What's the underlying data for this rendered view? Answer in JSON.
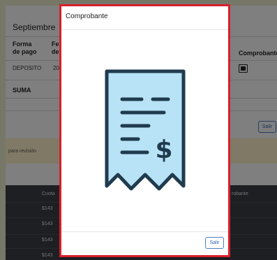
{
  "background": {
    "section_title": "Septiembre",
    "table_headers": [
      "Forma de pago",
      "Fe de",
      "Comprobante"
    ],
    "row": {
      "forma_pago": "DEPOSITO",
      "fecha": "20"
    },
    "suma_label": "SUMA",
    "salir_label": "Salir",
    "notice_text": "para revisión",
    "cuota_header": "Cuota",
    "comprobante_header": "robante",
    "cuota_values": [
      "$143",
      "$143",
      "$143",
      "$143"
    ]
  },
  "modal": {
    "title": "Comprobante",
    "receipt_icon": "receipt-icon",
    "salir_label": "Salir",
    "border_color": "#d6202a"
  }
}
